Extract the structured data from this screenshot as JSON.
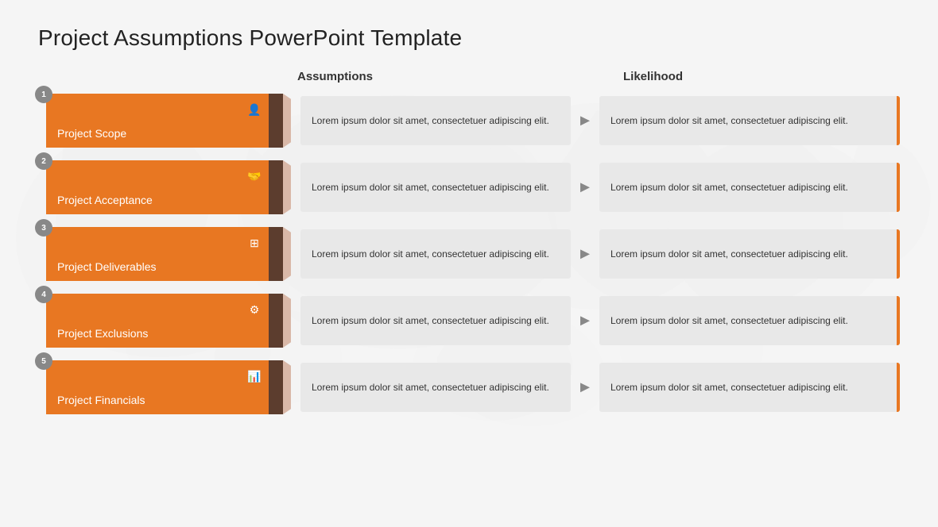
{
  "title": "Project Assumptions PowerPoint Template",
  "columns": {
    "assumptions": "Assumptions",
    "likelihood": "Likelihood"
  },
  "rows": [
    {
      "number": "1",
      "label": "Project Scope",
      "icon": "👤",
      "icon_name": "person-icon",
      "assumption": "Lorem ipsum dolor sit amet, consectetuer adipiscing elit.",
      "likelihood": "Lorem ipsum dolor sit amet, consectetuer adipiscing elit."
    },
    {
      "number": "2",
      "label": "Project Acceptance",
      "icon": "🤝",
      "icon_name": "handshake-icon",
      "assumption": "Lorem ipsum dolor sit amet, consectetuer adipiscing elit.",
      "likelihood": "Lorem ipsum dolor sit amet, consectetuer adipiscing elit."
    },
    {
      "number": "3",
      "label": "Project Deliverables",
      "icon": "⊞",
      "icon_name": "grid-icon",
      "assumption": "Lorem ipsum dolor sit amet, consectetuer adipiscing elit.",
      "likelihood": "Lorem ipsum dolor sit amet, consectetuer adipiscing elit."
    },
    {
      "number": "4",
      "label": "Project Exclusions",
      "icon": "⚙",
      "icon_name": "gear-icon",
      "assumption": "Lorem ipsum dolor sit amet, consectetuer adipiscing elit.",
      "likelihood": "Lorem ipsum dolor sit amet, consectetuer adipiscing elit."
    },
    {
      "number": "5",
      "label": "Project Financials",
      "icon": "📊",
      "icon_name": "chart-icon",
      "assumption": "Lorem ipsum dolor sit amet, consectetuer adipiscing elit.",
      "likelihood": "Lorem ipsum dolor sit amet, consectetuer adipiscing elit."
    }
  ]
}
